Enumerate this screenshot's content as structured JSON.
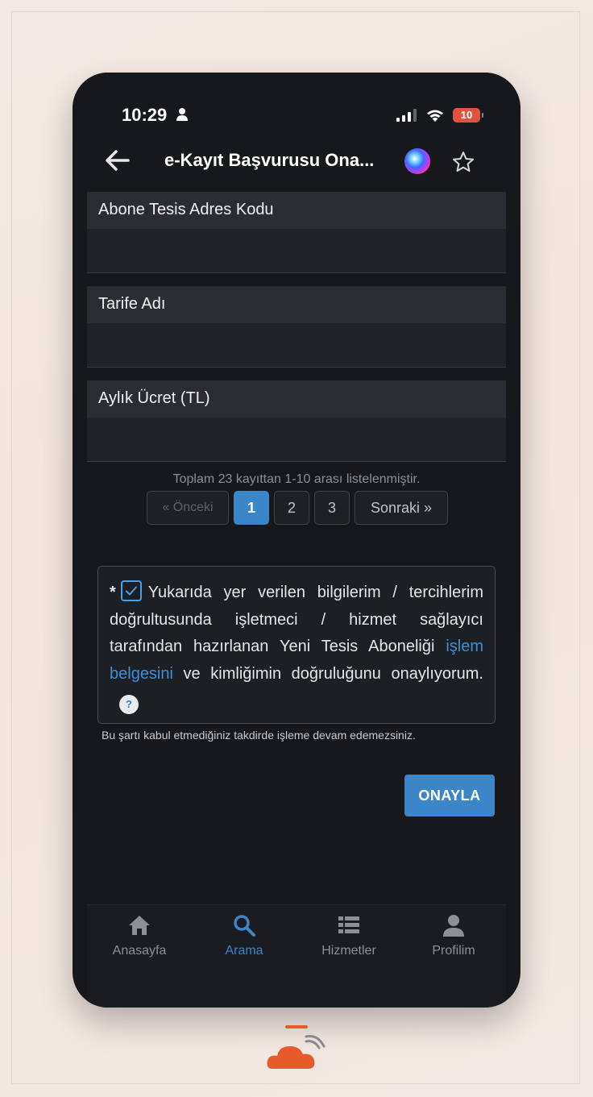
{
  "status_bar": {
    "time": "10:29",
    "battery": "10"
  },
  "navbar": {
    "title": "e-Kayıt Başvurusu Ona..."
  },
  "fields": [
    {
      "label": "Abone Tesis Adres Kodu",
      "value": ""
    },
    {
      "label": "Tarife Adı",
      "value": ""
    },
    {
      "label": "Aylık Ücret (TL)",
      "value": ""
    }
  ],
  "pagination": {
    "info": "Toplam 23 kayıttan 1-10 arası listelenmiştir.",
    "prev": "« Önceki",
    "pages": [
      "1",
      "2",
      "3"
    ],
    "active_page": "1",
    "next": "Sonraki »"
  },
  "consent": {
    "asterisk": "*",
    "text_before_link": "Yukarıda yer verilen bilgilerim / tercihlerim doğrultusunda işletmeci / hizmet sağlayıcı tarafından hazırlanan Yeni Tesis Aboneliği ",
    "link_text": "işlem belgesini",
    "text_after_link": " ve kimliğimin doğruluğunu onaylıyorum.",
    "checked": true,
    "help": "?",
    "note": "Bu şartı kabul etmediğiniz takdirde işleme devam edemezsiniz."
  },
  "confirm_button": "ONAYLA",
  "tabs": [
    {
      "label": "Anasayfa",
      "icon": "home-icon",
      "active": false
    },
    {
      "label": "Arama",
      "icon": "search-icon",
      "active": true
    },
    {
      "label": "Hizmetler",
      "icon": "list-icon",
      "active": false
    },
    {
      "label": "Profilim",
      "icon": "user-icon",
      "active": false
    }
  ],
  "colors": {
    "accent": "#3b86c9",
    "background": "#16181c",
    "battery": "#e0533f"
  }
}
